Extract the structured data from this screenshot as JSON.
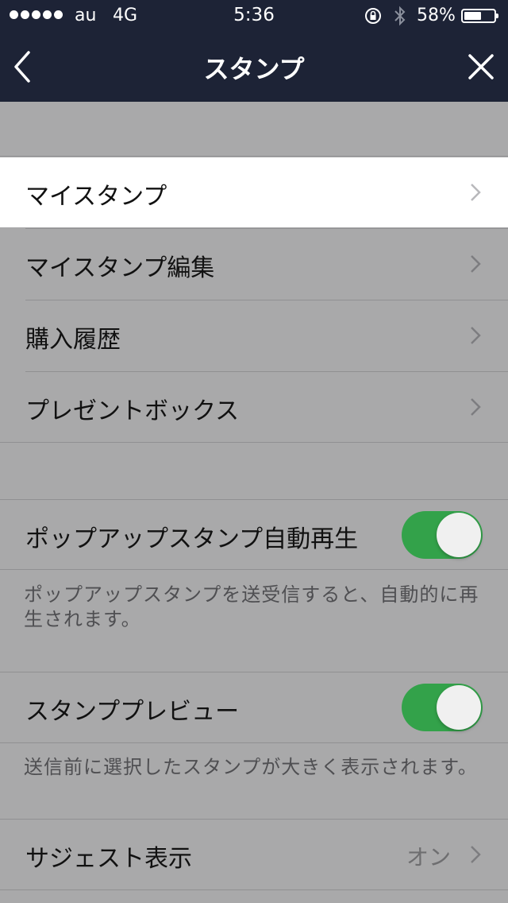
{
  "status_bar": {
    "carrier": "au",
    "network": "4G",
    "time": "5:36",
    "battery": "58%",
    "battery_level": 0.58
  },
  "nav": {
    "title": "スタンプ"
  },
  "menu": [
    {
      "label": "マイスタンプ"
    },
    {
      "label": "マイスタンプ編集"
    },
    {
      "label": "購入履歴"
    },
    {
      "label": "プレゼントボックス"
    }
  ],
  "settings": {
    "popup_autoplay": {
      "label": "ポップアップスタンプ自動再生",
      "enabled": true,
      "description": "ポップアップスタンプを送受信すると、自動的に再生されます。"
    },
    "sticker_preview": {
      "label": "スタンププレビュー",
      "enabled": true,
      "description": "送信前に選択したスタンプが大きく表示されます。"
    },
    "suggest": {
      "label": "サジェスト表示",
      "value": "オン"
    }
  },
  "colors": {
    "nav_bg": "#1d2336",
    "page_bg": "#a9a9aa",
    "toggle_on": "#33a24a",
    "highlight_row": "#ffffff"
  }
}
